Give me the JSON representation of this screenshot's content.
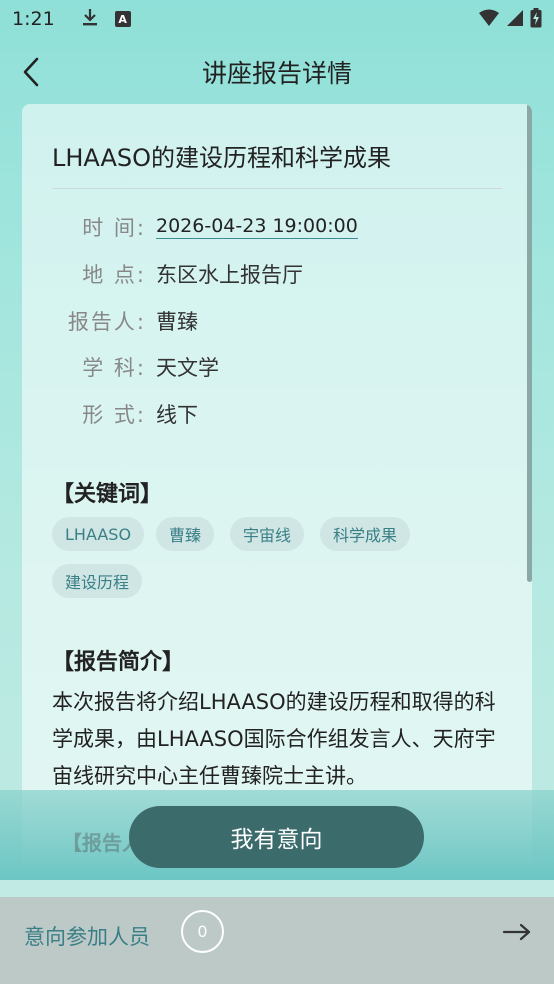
{
  "status_bar": {
    "time": "1:21"
  },
  "nav": {
    "title": "讲座报告详情"
  },
  "lecture": {
    "title": "LHAASO的建设历程和科学成果",
    "info": [
      {
        "label": "时 间:",
        "value": "2026-04-23 19:00:00"
      },
      {
        "label": "地 点:",
        "value": "东区水上报告厅"
      },
      {
        "label": "报告人:",
        "value": "曹臻"
      },
      {
        "label": "学 科:",
        "value": "天文学"
      },
      {
        "label": "形 式:",
        "value": "线下"
      }
    ],
    "keywords_heading": "【关键词】",
    "keywords": [
      "LHAASO",
      "曹臻",
      "宇宙线",
      "科学成果",
      "建设历程"
    ],
    "summary_heading": "【报告简介】",
    "summary": "本次报告将介绍LHAASO的建设历程和取得的科学成果，由LHAASO国际合作组发言人、天府宇宙线研究中心主任曹臻院士主讲。",
    "next_heading": "【报告人简介】"
  },
  "actions": {
    "intent_button": "我有意向"
  },
  "footer": {
    "label": "意向参加人员",
    "count": "0"
  },
  "colors": {
    "accent": "#3a7f86",
    "button": "#3c6b6c",
    "tag_bg": "#cfe6e5"
  }
}
